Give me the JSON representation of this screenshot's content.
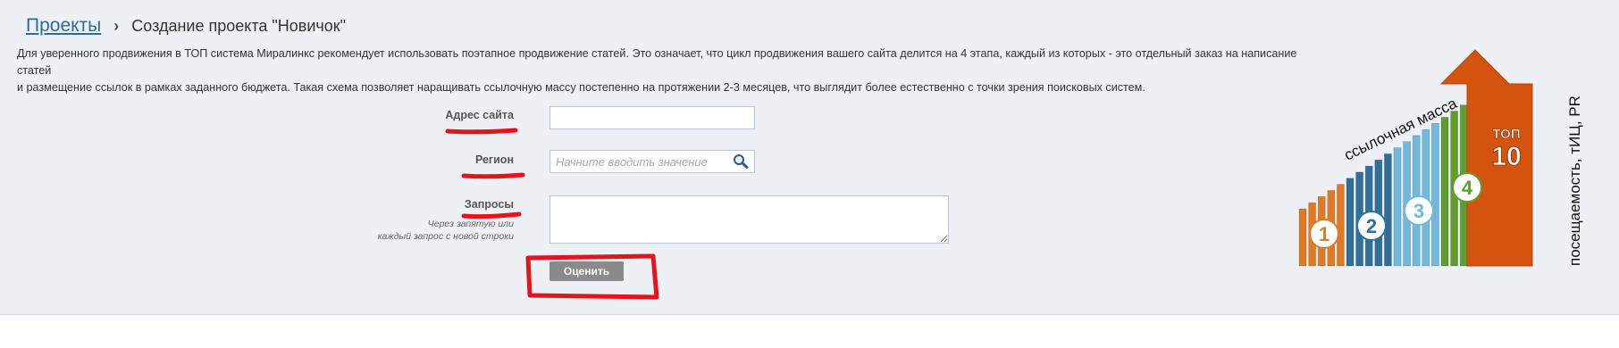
{
  "breadcrumb": {
    "projects_label": "Проекты",
    "separator": "›",
    "current_label": "Создание проекта \"Новичок\""
  },
  "intro": {
    "line1": "Для уверенного продвижения в ТОП система Миралинкс рекомендует использовать поэтапное продвижение статей. Это означает, что цикл продвижения вашего сайта делится на 4 этапа, каждый из которых - это отдельный заказ на написание статей",
    "line2": "и размещение ссылок в рамках заданного бюджета. Такая схема позволяет наращивать ссылочную массу постепенно на протяжении 2-3 месяцев, что выглядит более естественно с точки зрения поисковых систем."
  },
  "form": {
    "site_label": "Адрес сайта",
    "site_value": "",
    "region_label": "Регион",
    "region_placeholder": "Начните вводить значение",
    "queries_label": "Запросы",
    "queries_hint_line1": "Через запятую или",
    "queries_hint_line2": "каждый запрос с новой строки",
    "queries_value": "",
    "submit_label": "Оценить"
  },
  "promo": {
    "mass_label": "ссылочная масса",
    "stages": [
      "1",
      "2",
      "3",
      "4"
    ],
    "top_word": "ТОП",
    "top_number": "10",
    "vertical_label": "посещаемость, тИЦ, PR"
  },
  "colors": {
    "panel_bg": "#edf1f5",
    "link": "#2e6c94",
    "button_bg": "#8a8a8a",
    "annotation_red": "#e5141b",
    "stage1": "#e07a22",
    "stage2": "#2f6f99",
    "stage3": "#6fb9dc",
    "stage4": "#5f9e2e",
    "arrow": "#d4540f"
  }
}
